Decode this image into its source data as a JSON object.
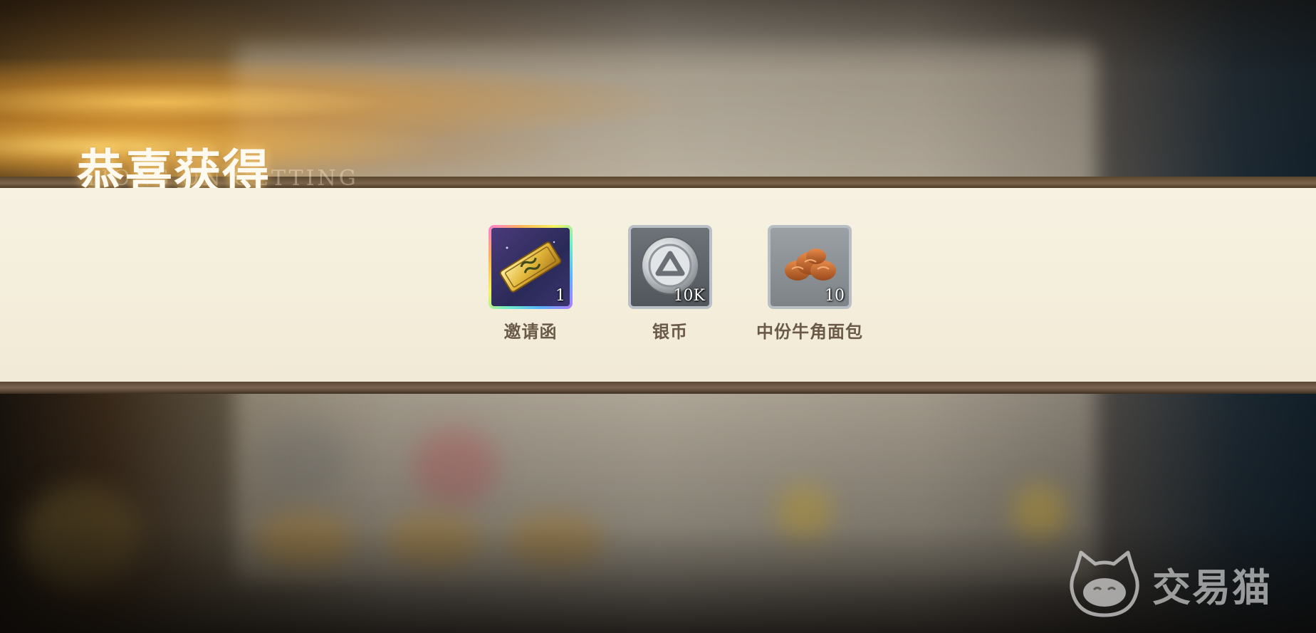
{
  "header": {
    "title": "恭喜获得",
    "subtitle": "TIONS ON GETTING"
  },
  "rewards": [
    {
      "name": "邀请函",
      "count": "1",
      "icon": "invitation-letter-icon",
      "frame": "rainbow"
    },
    {
      "name": "银币",
      "count": "10K",
      "icon": "silver-coin-icon",
      "frame": "silver"
    },
    {
      "name": "中份牛角面包",
      "count": "10",
      "icon": "croissant-icon",
      "frame": "grey"
    }
  ],
  "watermark": {
    "text": "交易猫",
    "icon": "cat-logo-icon"
  },
  "colors": {
    "banner": "#f4eedc",
    "label": "#6b5a48",
    "title_glow": "#ffd76e"
  }
}
